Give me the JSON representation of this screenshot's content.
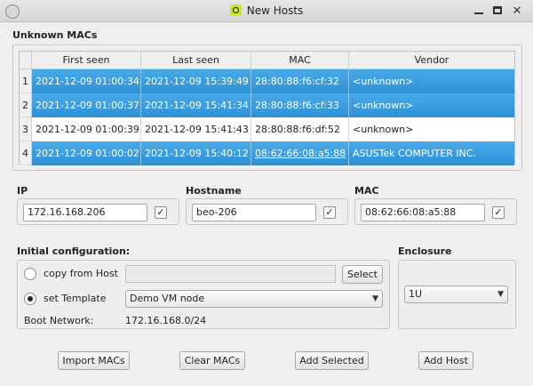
{
  "window": {
    "title": "New Hosts",
    "app_icon": "q-app-icon",
    "controls": [
      "minimize",
      "maximize",
      "close"
    ]
  },
  "unknown_macs": {
    "title": "Unknown MACs",
    "columns": [
      "First seen",
      "Last seen",
      "MAC",
      "Vendor"
    ],
    "rows": [
      {
        "num": "1",
        "first_seen": "2021-12-09 01:00:34",
        "last_seen": "2021-12-09 15:39:49",
        "mac": "28:80:88:f6:cf:32",
        "vendor": "<unknown>",
        "selected": true
      },
      {
        "num": "2",
        "first_seen": "2021-12-09 01:00:37",
        "last_seen": "2021-12-09 15:41:34",
        "mac": "28:80:88:f6:cf:33",
        "vendor": "<unknown>",
        "selected": true
      },
      {
        "num": "3",
        "first_seen": "2021-12-09 01:00:39",
        "last_seen": "2021-12-09 15:41:43",
        "mac": "28:80:88:f6:df:52",
        "vendor": "<unknown>",
        "selected": false
      },
      {
        "num": "4",
        "first_seen": "2021-12-09 01:00:02",
        "last_seen": "2021-12-09 15:40:12",
        "mac": "08:62:66:08:a5:88",
        "vendor": "ASUSTek COMPUTER INC.",
        "selected": true
      }
    ]
  },
  "ip": {
    "label": "IP",
    "value": "172.16.168.206",
    "checked": "✓"
  },
  "hostname": {
    "label": "Hostname",
    "value": "beo-206",
    "checked": "✓"
  },
  "mac": {
    "label": "MAC",
    "value": "08:62:66:08:a5:88",
    "checked": "✓"
  },
  "initial_config": {
    "title": "Initial configuration:",
    "copy_from_host_label": "copy from Host",
    "copy_from_host_value": "",
    "select_button": "Select",
    "set_template_label": "set Template",
    "template_value": "Demo VM node",
    "boot_network_label": "Boot Network:",
    "boot_network_value": "172.16.168.0/24"
  },
  "enclosure": {
    "title": "Enclosure",
    "value": "1U"
  },
  "buttons": {
    "import_macs": "Import MACs",
    "clear_macs": "Clear MACs",
    "add_selected": "Add Selected",
    "add_host": "Add Host"
  },
  "colors": {
    "selection": "#3a9be0",
    "window_bg": "#efefef"
  }
}
